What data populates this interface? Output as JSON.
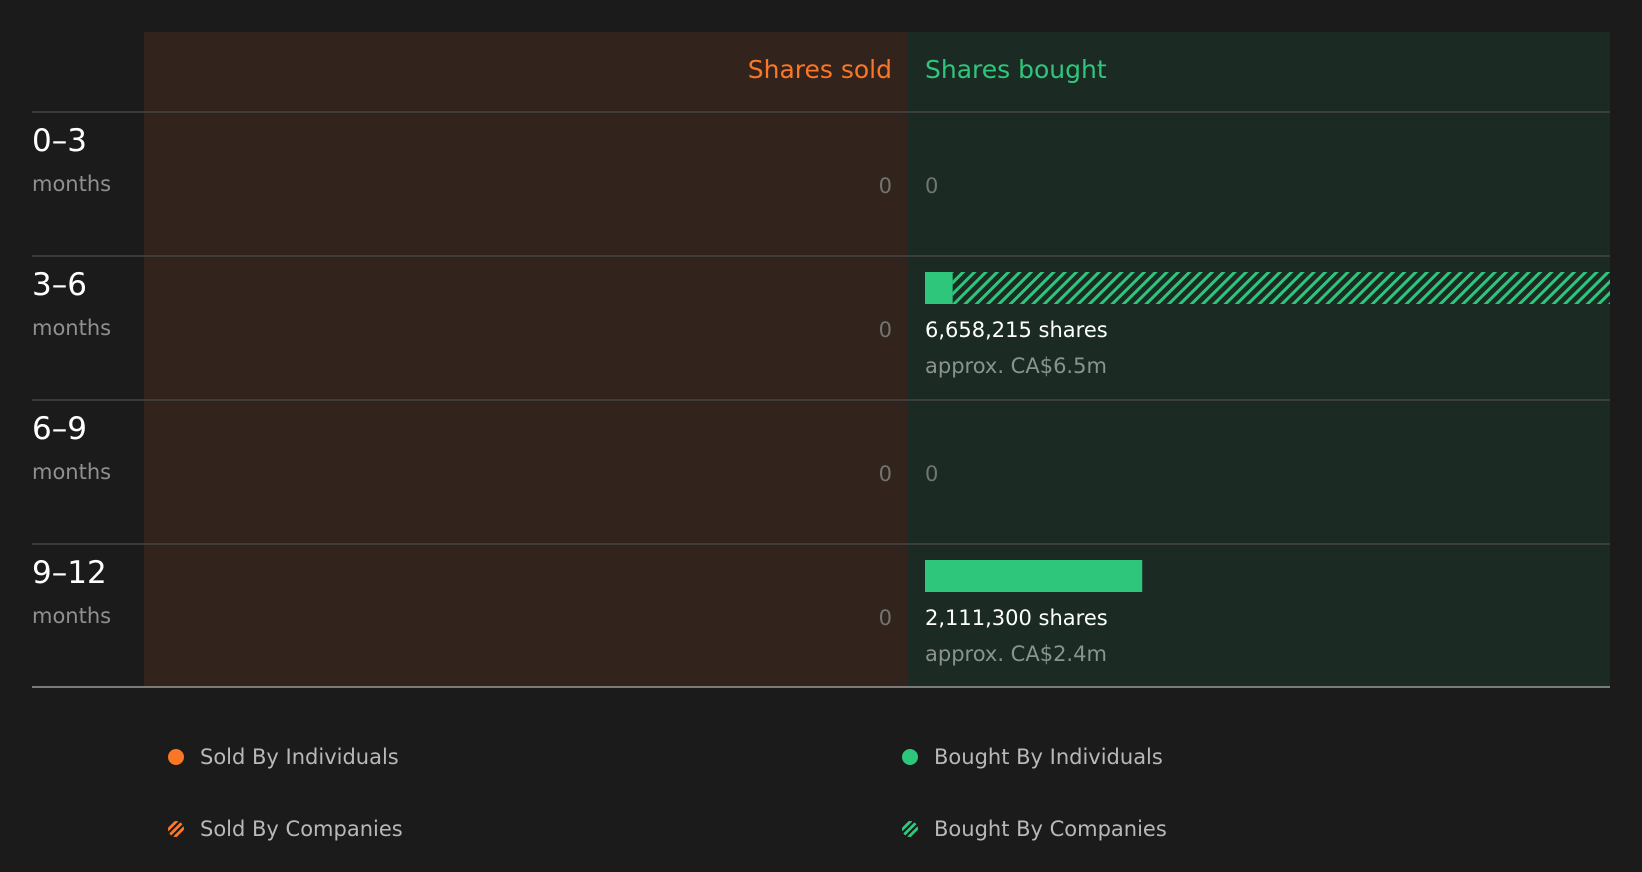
{
  "chart_data": {
    "type": "bar",
    "orientation": "horizontal-diverging",
    "headers": {
      "sold": "Shares sold",
      "bought": "Shares bought"
    },
    "categories": [
      {
        "range": "0–3",
        "unit": "months"
      },
      {
        "range": "3–6",
        "unit": "months"
      },
      {
        "range": "6–9",
        "unit": "months"
      },
      {
        "range": "9–12",
        "unit": "months"
      }
    ],
    "sold": [
      {
        "individuals": 0,
        "companies": 0,
        "label": "0"
      },
      {
        "individuals": 0,
        "companies": 0,
        "label": "0"
      },
      {
        "individuals": 0,
        "companies": 0,
        "label": "0"
      },
      {
        "individuals": 0,
        "companies": 0,
        "label": "0"
      }
    ],
    "bought": [
      {
        "individuals": 0,
        "companies": 0,
        "label": "0",
        "approx": ""
      },
      {
        "individuals": 270000,
        "companies": 6388215,
        "label": "6,658,215 shares",
        "approx": "approx. CA$6.5m"
      },
      {
        "individuals": 0,
        "companies": 0,
        "label": "0",
        "approx": ""
      },
      {
        "individuals": 2111300,
        "companies": 0,
        "label": "2,111,300 shares",
        "approx": "approx. CA$2.4m"
      }
    ],
    "max_shares": 6658215,
    "legend": [
      {
        "label": "Sold By Individuals",
        "side": "sold",
        "kind": "individuals"
      },
      {
        "label": "Bought By Individuals",
        "side": "bought",
        "kind": "individuals"
      },
      {
        "label": "Sold By Companies",
        "side": "sold",
        "kind": "companies"
      },
      {
        "label": "Bought By Companies",
        "side": "bought",
        "kind": "companies"
      }
    ],
    "legend_placement": "bottom"
  },
  "colors": {
    "background": "#1b1b1b",
    "sold_panel": "#32241c",
    "bought_panel": "#1b2b24",
    "sold": "#fb7625",
    "bought": "#2ec67b",
    "label_primary": "#ffffff",
    "label_secondary": "#909090",
    "zero_value": "#6f7571",
    "approx": "#8a938e",
    "divider": "#454545",
    "baseline": "#9a9a9a"
  }
}
